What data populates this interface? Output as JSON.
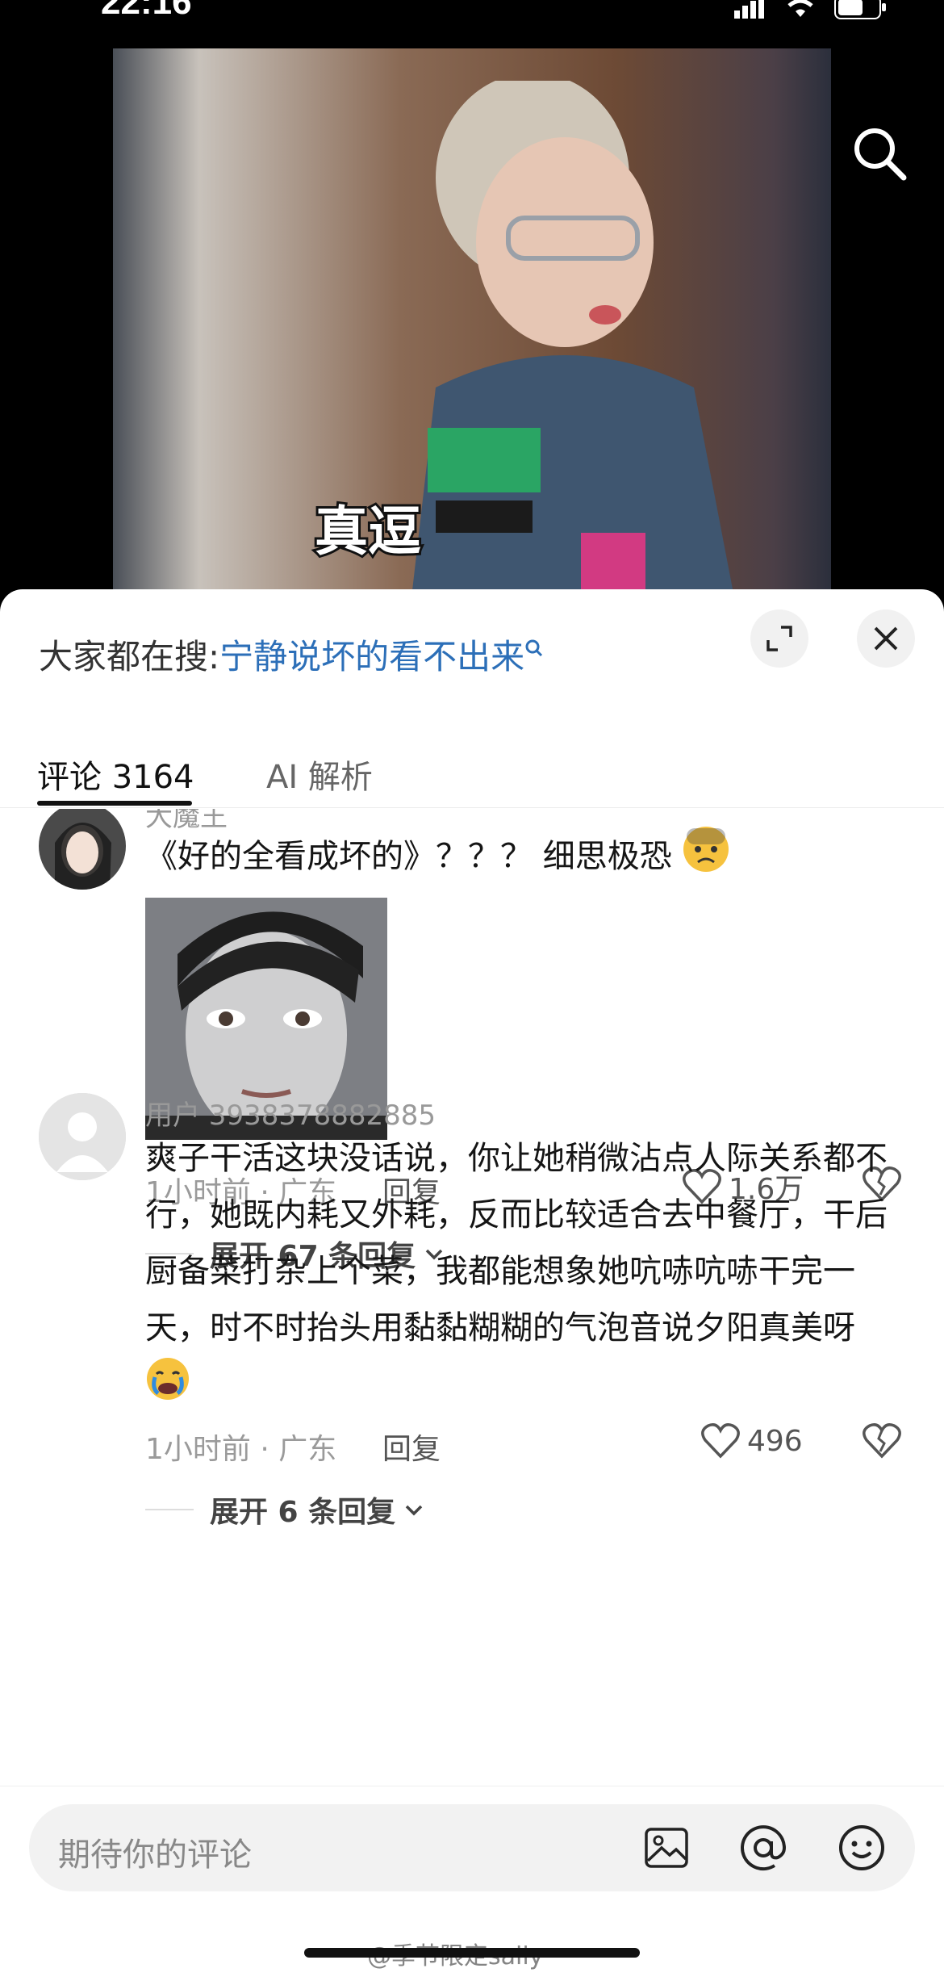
{
  "status_bar": {
    "time": "22:16"
  },
  "video": {
    "caption": "真逗"
  },
  "search_bar": {
    "prefix": "大家都在搜:",
    "query": "宁静说坏的看不出来"
  },
  "tabs": [
    {
      "label": "评论 3164"
    },
    {
      "label": "AI 解析"
    }
  ],
  "comments": [
    {
      "username": "大魔王",
      "text": "《好的全看成坏的》？？？ 细思极恐",
      "time_location": "1小时前 · 广东",
      "reply_label": "回复",
      "likes": "1.6万",
      "expand_label": "展开 67 条回复"
    },
    {
      "username": "用户 3938378882885",
      "text": "爽子干活这块没话说，你让她稍微沾点人际关系都不行，她既内耗又外耗，反而比较适合去中餐厅，干后厨备菜打杂上个菜，我都能想象她吭哧吭哧干完一天，时不时抬头用黏黏糊糊的气泡音说夕阳真美呀",
      "time_location": "1小时前 · 广东",
      "reply_label": "回复",
      "likes": "496",
      "expand_label": "展开 6 条回复"
    }
  ],
  "comment_input": {
    "placeholder": "期待你的评论"
  },
  "watermark": "@季节限定sally"
}
